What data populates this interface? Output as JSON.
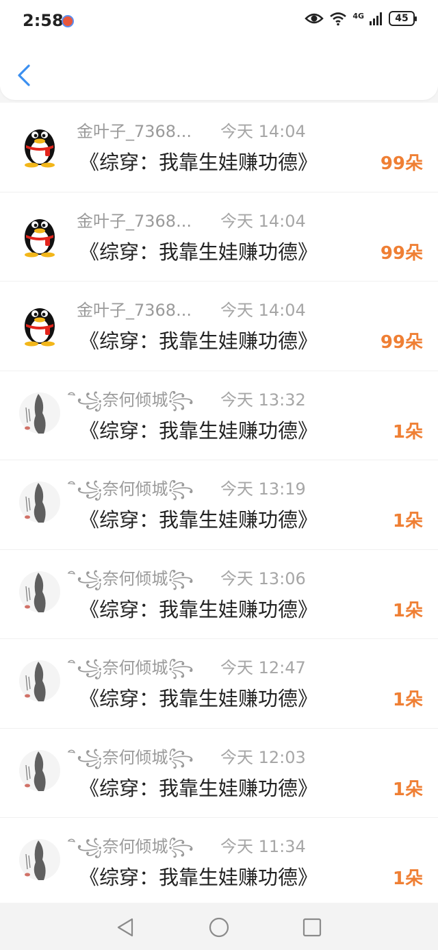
{
  "status": {
    "time": "2:58",
    "battery": "45",
    "network": "4G"
  },
  "header": {
    "back_icon": "chevron-left-icon"
  },
  "items": [
    {
      "sender": "金叶子_7368...",
      "time": "今天 14:04",
      "title": "《综穿：我靠生娃赚功德》",
      "count": "99朵",
      "avatar": "penguin"
    },
    {
      "sender": "金叶子_7368...",
      "time": "今天 14:04",
      "title": "《综穿：我靠生娃赚功德》",
      "count": "99朵",
      "avatar": "penguin"
    },
    {
      "sender": "金叶子_7368...",
      "time": "今天 14:04",
      "title": "《综穿：我靠生娃赚功德》",
      "count": "99朵",
      "avatar": "penguin"
    },
    {
      "sender": "ิ꧁奈何倾城꧂",
      "time": "今天 13:32",
      "title": "《综穿：我靠生娃赚功德》",
      "count": "1朵",
      "avatar": "ink-figure"
    },
    {
      "sender": "ิ꧁奈何倾城꧂",
      "time": "今天 13:19",
      "title": "《综穿：我靠生娃赚功德》",
      "count": "1朵",
      "avatar": "ink-figure"
    },
    {
      "sender": "ิ꧁奈何倾城꧂",
      "time": "今天 13:06",
      "title": "《综穿：我靠生娃赚功德》",
      "count": "1朵",
      "avatar": "ink-figure"
    },
    {
      "sender": "ิ꧁奈何倾城꧂",
      "time": "今天 12:47",
      "title": "《综穿：我靠生娃赚功德》",
      "count": "1朵",
      "avatar": "ink-figure"
    },
    {
      "sender": "ิ꧁奈何倾城꧂",
      "time": "今天 12:03",
      "title": "《综穿：我靠生娃赚功德》",
      "count": "1朵",
      "avatar": "ink-figure"
    },
    {
      "sender": "ิ꧁奈何倾城꧂",
      "time": "今天 11:34",
      "title": "《综穿：我靠生娃赚功德》",
      "count": "1朵",
      "avatar": "ink-figure"
    }
  ],
  "colors": {
    "accent": "#ef7f34",
    "link": "#3b8ff0",
    "text": "#222222",
    "muted": "#9a9a9a"
  }
}
